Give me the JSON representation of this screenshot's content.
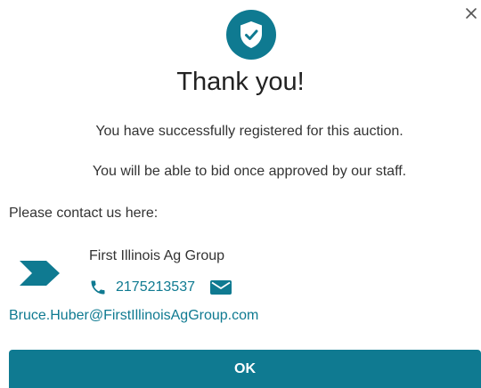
{
  "dialog": {
    "title": "Thank you!",
    "messages": [
      "You have successfully registered for this auction.",
      "You will be able to bid once approved by our staff."
    ],
    "contact_prompt": "Please contact us here:",
    "icons": {
      "header": "shield-check-icon",
      "close": "close-icon",
      "logo": "chevron-right-logo",
      "phone": "phone-icon",
      "mail": "mail-icon"
    },
    "contact": {
      "company": "First Illinois Ag Group",
      "phone": "2175213537",
      "email": "Bruce.Huber@FirstIllinoisAgGroup.com"
    },
    "ok_label": "OK"
  },
  "colors": {
    "accent": "#0f7a91",
    "text": "#333333",
    "background": "#ffffff"
  }
}
